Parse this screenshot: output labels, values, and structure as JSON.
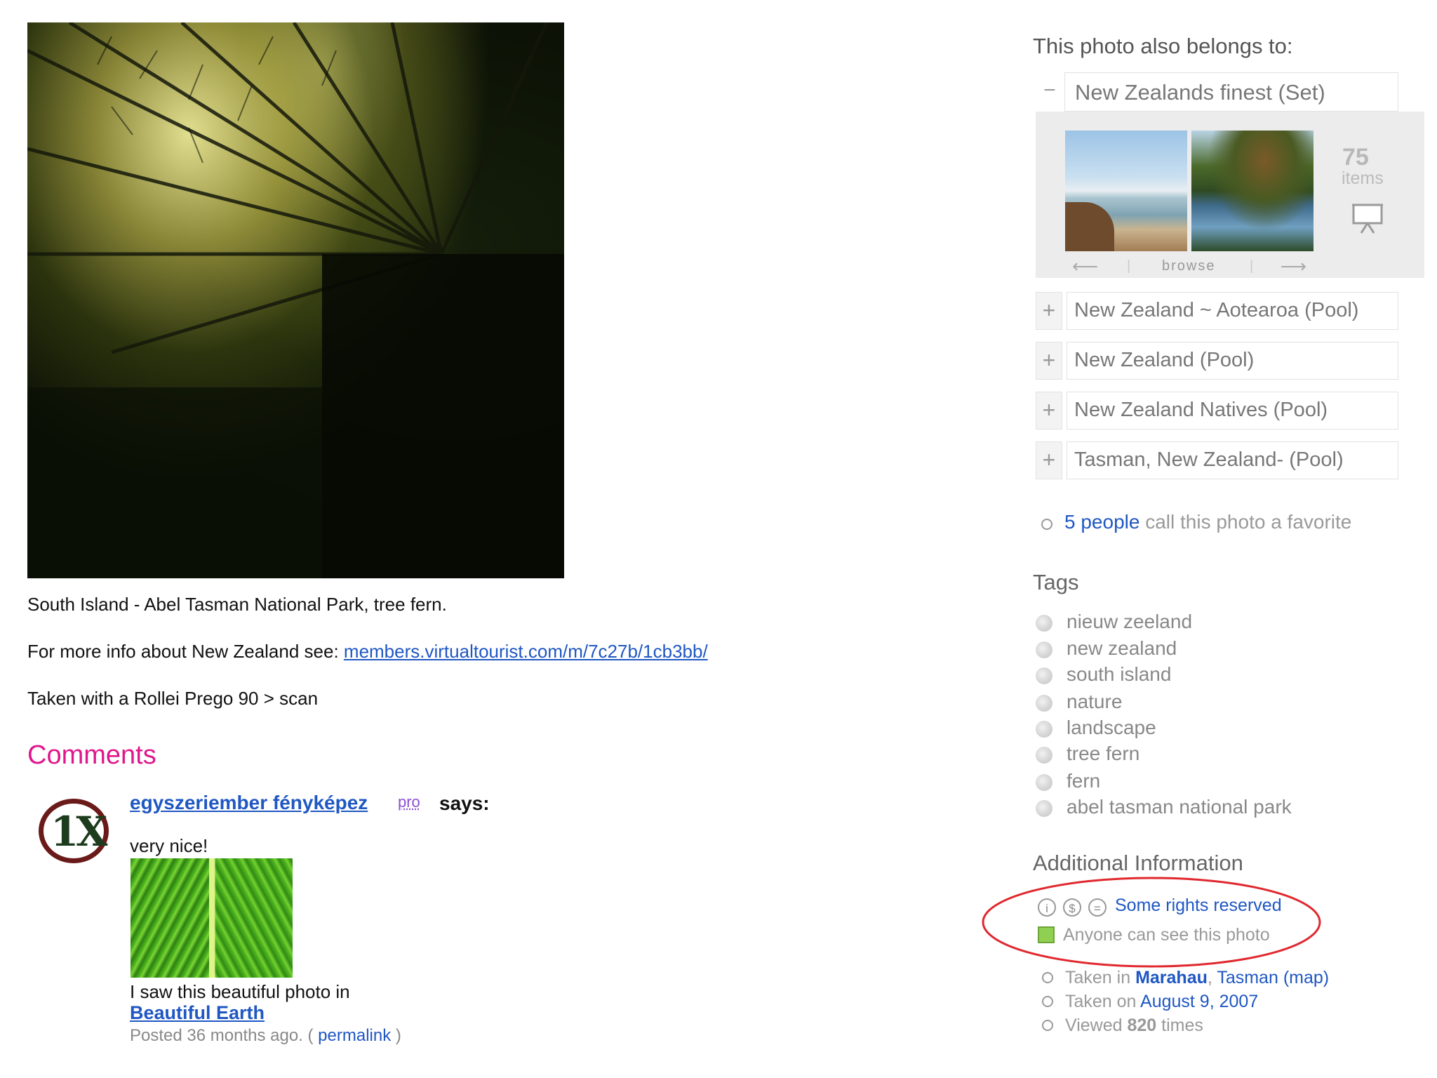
{
  "photo": {
    "caption": "South Island - Abel Tasman National Park, tree fern.",
    "more_info_prefix": "For more info about New Zealand see: ",
    "more_info_link": "members.virtualtourist.com/m/7c27b/1cb3bb/",
    "camera": "Taken with a Rollei Prego 90 > scan"
  },
  "comments": {
    "heading": "Comments",
    "items": [
      {
        "avatar_text": "1X",
        "author": "egyszeriember fényképez",
        "badge": "pro",
        "says": "says:",
        "text": "very nice!",
        "line": "I saw this beautiful photo in",
        "group_link": "Beautiful Earth",
        "posted_prefix": "Posted 36 months ago. (",
        "permalink": "permalink",
        "posted_suffix": ")"
      }
    ]
  },
  "sidebar": {
    "belongs_heading": "This photo also belongs to:",
    "set": {
      "collapse_symbol": "−",
      "title": "New Zealands finest (Set)",
      "count": "75",
      "count_label": "items",
      "browse_label": "browse",
      "prev_arrow": "⟵",
      "next_arrow": "⟶",
      "separator": "|"
    },
    "pools": [
      {
        "symbol": "+",
        "label": "New Zealand ~ Aotearoa (Pool)"
      },
      {
        "symbol": "+",
        "label": "New Zealand (Pool)"
      },
      {
        "symbol": "+",
        "label": "New Zealand Natives (Pool)"
      },
      {
        "symbol": "+",
        "label": "Tasman, New Zealand- (Pool)"
      }
    ],
    "favorites": {
      "link": "5 people",
      "text": " call this photo a favorite"
    },
    "tags_heading": "Tags",
    "tags": [
      "nieuw zeeland",
      "new zealand",
      "south island",
      "nature",
      "landscape",
      "tree fern",
      "fern",
      "abel tasman national park"
    ],
    "additional_heading": "Additional Information",
    "license": {
      "icons": [
        "i",
        "$",
        "="
      ],
      "text": "Some rights reserved"
    },
    "visibility": "Anyone can see this photo",
    "info": {
      "taken_in_prefix": "Taken in ",
      "place": "Marahau",
      "place_sep": ", ",
      "region": "Tasman",
      "map": "(map)",
      "taken_on_prefix": "Taken on ",
      "date": "August 9, 2007",
      "viewed_prefix": "Viewed ",
      "views": "820",
      "viewed_suffix": " times"
    }
  },
  "colors": {
    "link": "#1f57c3",
    "comments_heading": "#e0178c",
    "annotation": "#e0282e"
  }
}
